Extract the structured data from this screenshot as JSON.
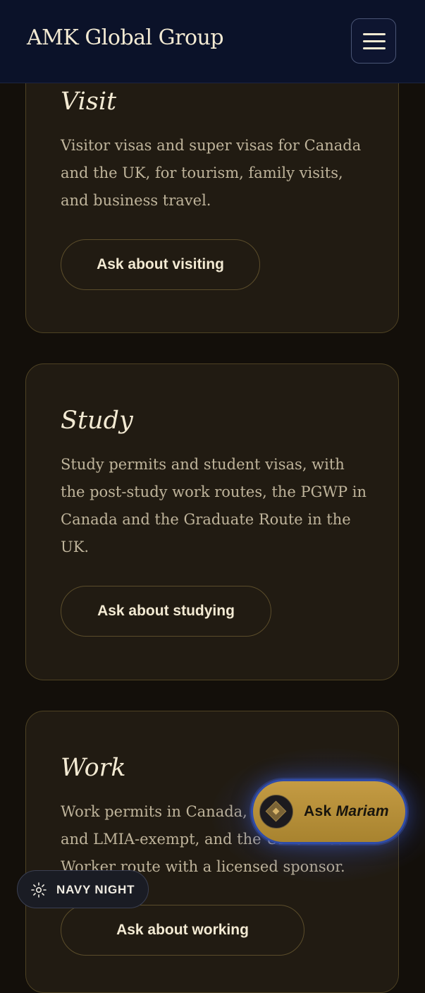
{
  "header": {
    "brand": "AMK Global Group",
    "menu_icon": "hamburger-menu-icon"
  },
  "cards": [
    {
      "title": "Visit",
      "description": "Visitor visas and super visas for Canada and the UK, for tourism, family visits, and business travel.",
      "button": "Ask about visiting"
    },
    {
      "title": "Study",
      "description": "Study permits and student visas, with the post-study work routes, the PGWP in Canada and the Graduate Route in the UK.",
      "button": "Ask about studying"
    },
    {
      "title": "Work",
      "description": "Work permits in Canada, LMIA-based and LMIA-exempt, and the UK Skilled Worker route with a licensed sponsor.",
      "button": "Ask about working"
    }
  ],
  "assistant": {
    "prefix": "Ask",
    "name": "Mariam",
    "avatar_icon": "diamond-icon"
  },
  "theme": {
    "label": "NAVY NIGHT",
    "icon": "sun-icon"
  },
  "colors": {
    "header_bg": "#0b1229",
    "page_bg": "#130f0a",
    "card_bg": "#211b12",
    "card_border": "#4e4223",
    "heading_text": "#f3ead3",
    "body_text": "#bfb49b",
    "assistant_gold": "#b58d38",
    "assistant_ring": "#2f4ca8"
  }
}
